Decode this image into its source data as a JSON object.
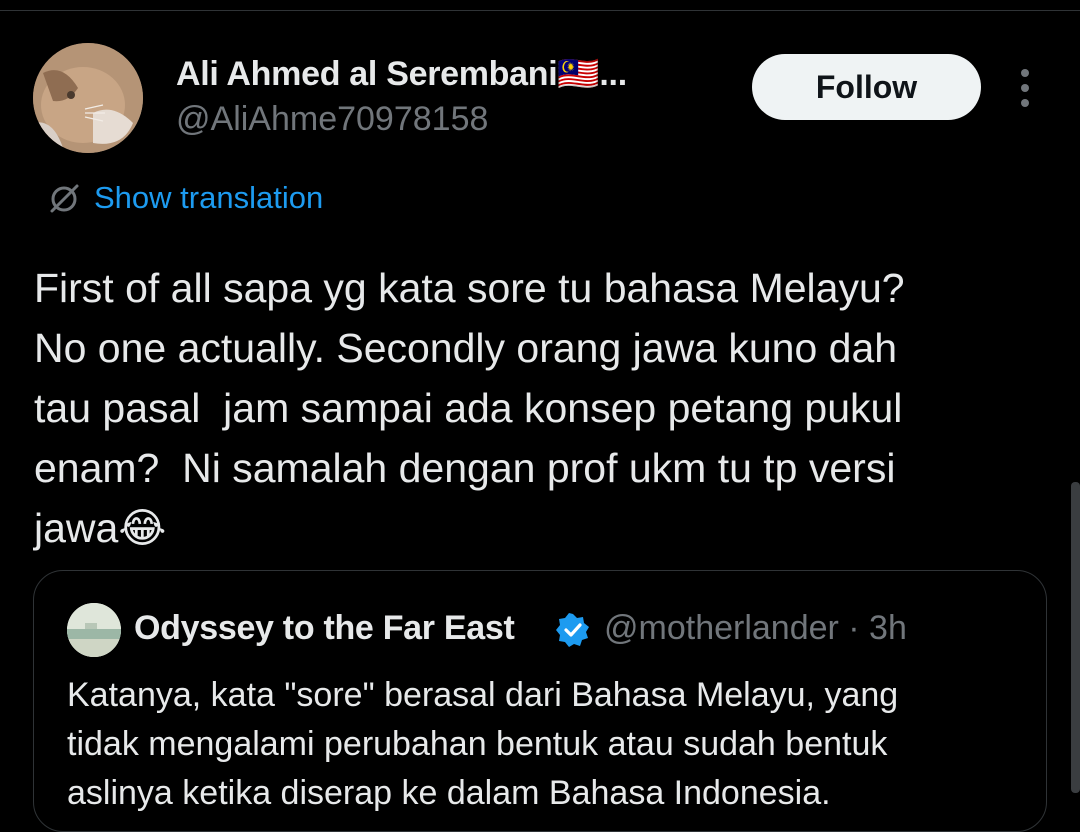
{
  "tweet": {
    "author": {
      "display_name": "Ali Ahmed al Serembani🇲🇾...",
      "handle": "@AliAhme70978158",
      "avatar_icon": "cat-avatar"
    },
    "follow_label": "Follow",
    "more_icon": "more-vertical-icon",
    "translation_label": "Show translation",
    "text": "First of all sapa yg kata sore tu bahasa Melayu?\nNo one actually. Secondly orang jawa kuno dah\ntau pasal  jam sampai ada konsep petang pukul\nenam?  Ni samalah dengan prof ukm tu tp versi\njawa😂"
  },
  "quote": {
    "author": "Odyssey to the Far East",
    "handle_time": "@motherlander · 3h",
    "verified_icon": "verified-badge-icon",
    "text": "Katanya, kata \"sore\" berasal dari Bahasa Melayu, yang\ntidak mengalami perubahan bentuk atau sudah bentuk\naslinya ketika diserap ke dalam Bahasa Indonesia."
  },
  "colors": {
    "background": "#000000",
    "text": "#e7e9ea",
    "muted": "#71767b",
    "accent": "#1d9bf0",
    "border": "#2f3336"
  }
}
